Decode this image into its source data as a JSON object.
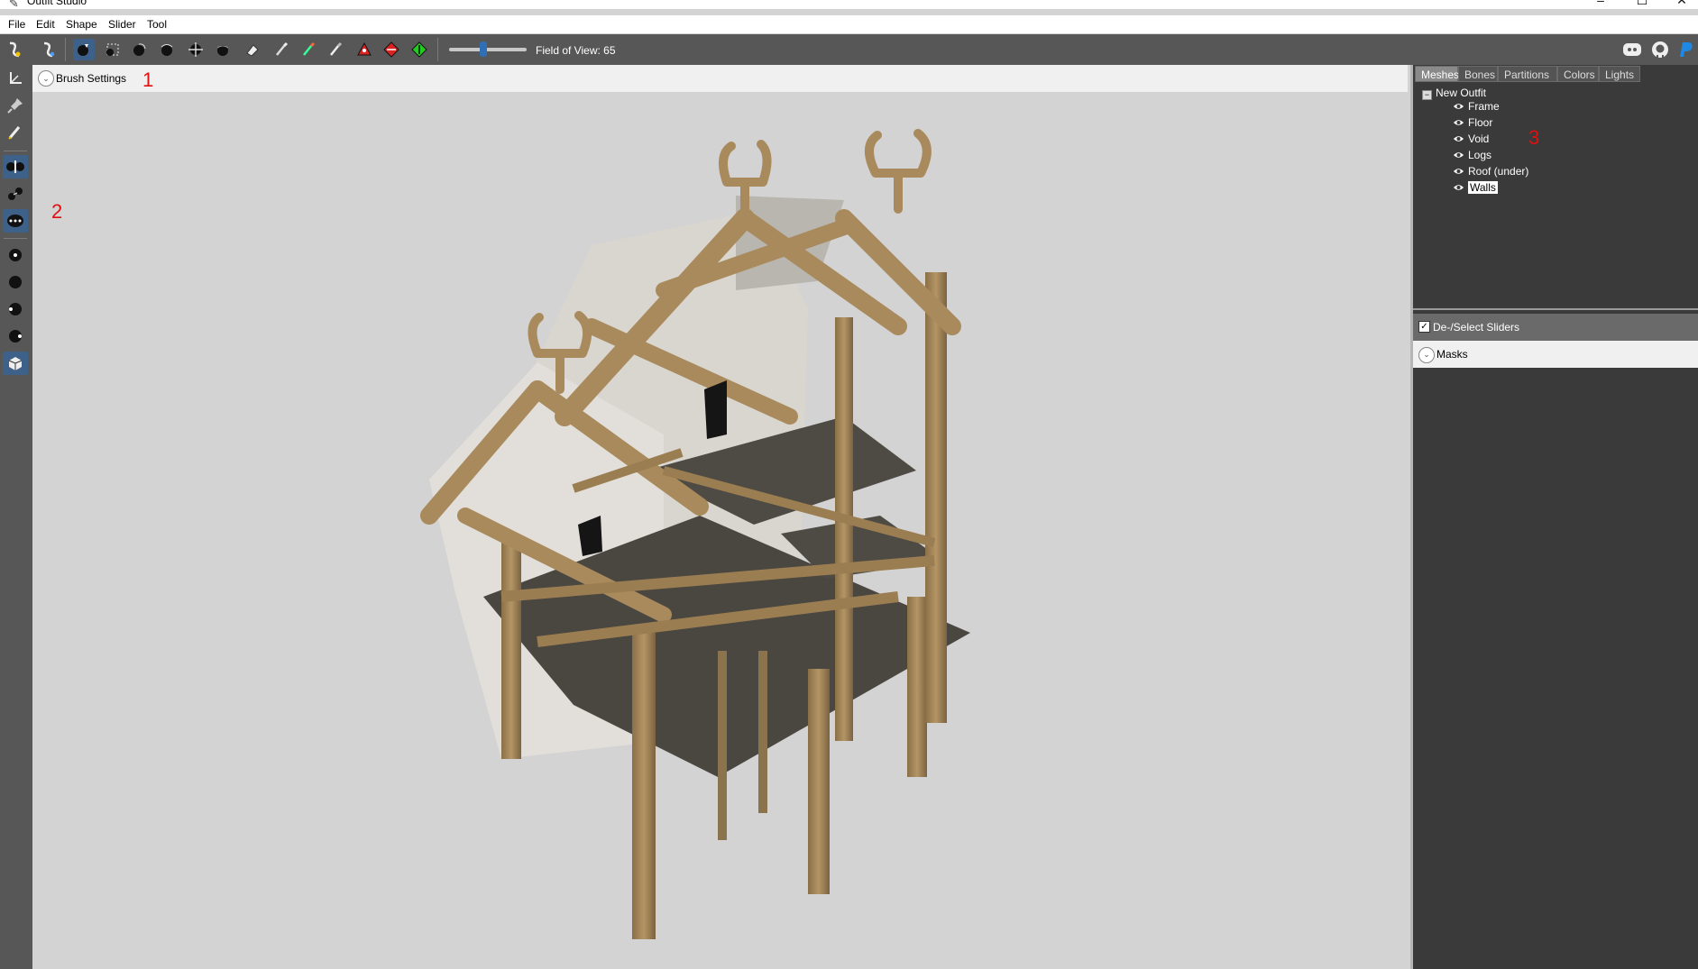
{
  "window": {
    "title": "Outfit Studio",
    "controls": {
      "minimize": "–",
      "maximize": "☐",
      "close": "✕"
    }
  },
  "menu": [
    "File",
    "Edit",
    "Shape",
    "Slider",
    "Tool"
  ],
  "toolbar": {
    "fov_label": "Field of View: 65",
    "fov_value": 65
  },
  "brush_settings": {
    "label": "Brush Settings"
  },
  "right_panel": {
    "tabs": [
      "Meshes",
      "Bones",
      "Partitions",
      "Colors",
      "Lights"
    ],
    "active_tab": "Meshes",
    "tree": {
      "root": "New Outfit",
      "items": [
        "Frame",
        "Floor",
        "Void",
        "Logs",
        "Roof (under)",
        "Walls"
      ],
      "selected": "Walls"
    },
    "deselect_sliders": {
      "label": "De-/Select Sliders",
      "checked": true
    },
    "masks": {
      "label": "Masks"
    }
  },
  "annotations": [
    "1",
    "2",
    "3"
  ],
  "colors": {
    "toolbar": "#575757",
    "active_tool": "#3d6189",
    "panel": "#3a3a3a",
    "viewport": "#d3d3d3",
    "annotation": "#e01010"
  }
}
